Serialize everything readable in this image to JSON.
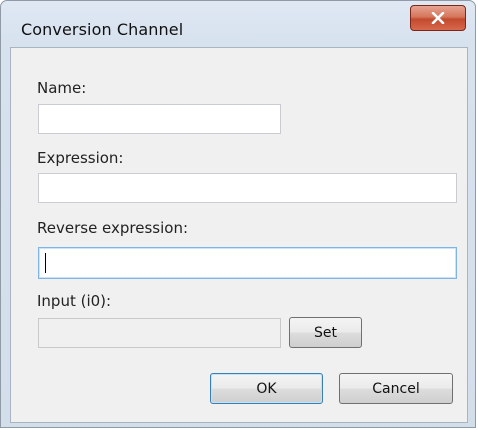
{
  "window": {
    "title": "Conversion Channel",
    "close_icon": "close-x-icon"
  },
  "form": {
    "name_label": "Name:",
    "name_value": "",
    "expression_label": "Expression:",
    "expression_value": "",
    "reverse_expression_label": "Reverse expression:",
    "reverse_expression_value": "",
    "input_label": "Input (i0):",
    "input_value": "",
    "set_label": "Set"
  },
  "buttons": {
    "ok_label": "OK",
    "cancel_label": "Cancel"
  },
  "colors": {
    "frame": "#d3deeb",
    "client": "#f0f0f0",
    "close_button": "#c24b2e",
    "focus_border": "#7fb4e6"
  }
}
